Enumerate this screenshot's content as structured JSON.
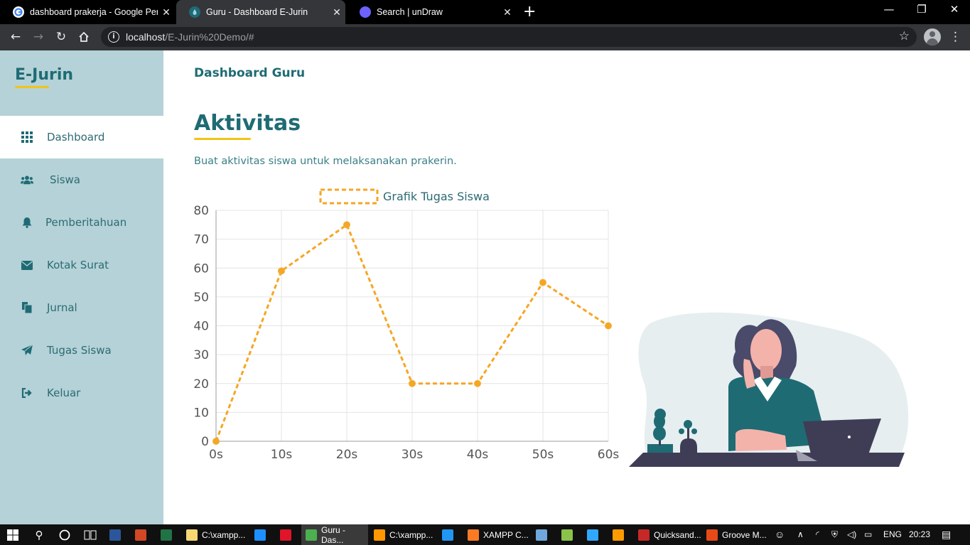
{
  "browser": {
    "tabs": [
      {
        "title": "dashboard prakerja - Google Pen",
        "favicon_color": "#ffffff"
      },
      {
        "title": "Guru - Dashboard E-Jurin",
        "favicon_color": "#4a90d9"
      },
      {
        "title": "Search | unDraw",
        "favicon_color": "#6c63ff"
      }
    ],
    "close_glyph": "✕",
    "new_tab_glyph": "+",
    "url_host": "localhost",
    "url_path": "/E-Jurin%20Demo/#",
    "window_controls": {
      "minimize": "—",
      "restore": "❐",
      "close": "✕"
    }
  },
  "sidebar": {
    "brand": "E-Jurin",
    "items": [
      {
        "label": "Dashboard",
        "icon": "grid-icon",
        "active": true
      },
      {
        "label": "Siswa",
        "icon": "users-icon",
        "active": false
      },
      {
        "label": "Pemberitahuan",
        "icon": "bell-icon",
        "active": false
      },
      {
        "label": "Kotak Surat",
        "icon": "envelope-icon",
        "active": false
      },
      {
        "label": "Jurnal",
        "icon": "files-icon",
        "active": false
      },
      {
        "label": "Tugas Siswa",
        "icon": "paper-plane-icon",
        "active": false
      },
      {
        "label": "Keluar",
        "icon": "sign-out-icon",
        "active": false
      }
    ]
  },
  "main": {
    "header": "Dashboard Guru",
    "section_title": "Aktivitas",
    "section_desc": "Buat aktivitas siswa untuk melaksanakan prakerin."
  },
  "chart_data": {
    "type": "line",
    "x": [
      "0s",
      "10s",
      "20s",
      "30s",
      "40s",
      "50s",
      "60s"
    ],
    "series": [
      {
        "name": "Grafik Tugas Siswa",
        "values": [
          0,
          59,
          75,
          20,
          20,
          55,
          40
        ],
        "color": "#f5a623",
        "dashed": true
      }
    ],
    "ylim": [
      0,
      80
    ],
    "yticks": [
      0,
      10,
      20,
      30,
      40,
      50,
      60,
      70,
      80
    ],
    "grid": true,
    "legend_position": "top"
  },
  "taskbar": {
    "items": [
      {
        "label": "",
        "icon": "word-icon",
        "color": "#2b579a"
      },
      {
        "label": "",
        "icon": "powerpoint-icon",
        "color": "#d24726"
      },
      {
        "label": "",
        "icon": "excel-icon",
        "color": "#217346"
      },
      {
        "label": "C:\\xampp...",
        "icon": "folder-icon",
        "color": "#f8d775"
      },
      {
        "label": "",
        "icon": "edge-icon",
        "color": "#1e90ff"
      },
      {
        "label": "",
        "icon": "opera-icon",
        "color": "#e0152a"
      },
      {
        "label": "Guru - Das...",
        "icon": "chrome-icon",
        "color": "#4caf50",
        "active": true
      },
      {
        "label": "C:\\xampp...",
        "icon": "sublime-icon",
        "color": "#ff9800"
      },
      {
        "label": "",
        "icon": "vscode-icon",
        "color": "#2196f3"
      },
      {
        "label": "XAMPP C...",
        "icon": "xampp-icon",
        "color": "#fb7a24"
      },
      {
        "label": "",
        "icon": "virtualbox-icon",
        "color": "#6fa8dc"
      },
      {
        "label": "",
        "icon": "notepadpp-icon",
        "color": "#8bc34a"
      },
      {
        "label": "",
        "icon": "photoshop-icon",
        "color": "#31a8ff"
      },
      {
        "label": "",
        "icon": "illustrator-icon",
        "color": "#ff9a00"
      },
      {
        "label": "Quicksand...",
        "icon": "font-icon",
        "color": "#c62828"
      },
      {
        "label": "Groove M...",
        "icon": "groove-icon",
        "color": "#e64a19"
      }
    ],
    "lang": "ENG",
    "time": "20:23"
  }
}
